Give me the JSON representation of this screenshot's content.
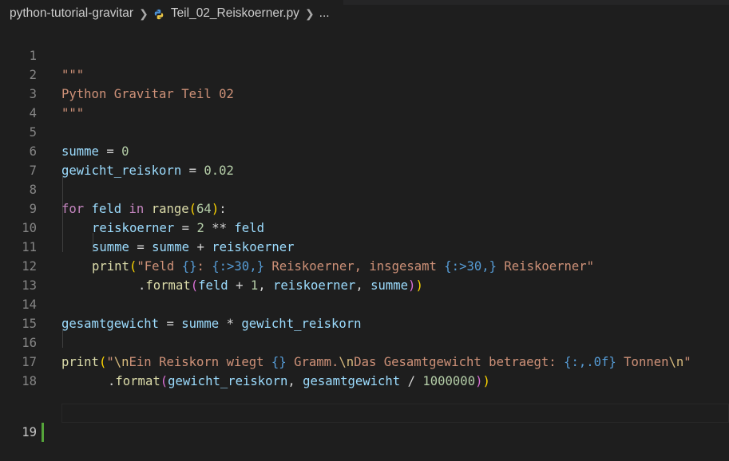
{
  "breadcrumb": {
    "folder": "python-tutorial-gravitar",
    "file": "Teil_02_Reiskoerner.py",
    "tail": "..."
  },
  "editor": {
    "active_line": 19,
    "lines": [
      {
        "num": "1"
      },
      {
        "num": "2"
      },
      {
        "num": "3"
      },
      {
        "num": "4"
      },
      {
        "num": "5"
      },
      {
        "num": "6"
      },
      {
        "num": "7"
      },
      {
        "num": "8"
      },
      {
        "num": "9"
      },
      {
        "num": "10"
      },
      {
        "num": "11"
      },
      {
        "num": "12"
      },
      {
        "num": "13"
      },
      {
        "num": "14"
      },
      {
        "num": "15"
      },
      {
        "num": "16"
      },
      {
        "num": "17"
      },
      {
        "num": "18"
      },
      {
        "num": "19"
      }
    ],
    "tokens": {
      "l1": "\"\"\"",
      "l2": "Python Gravitar Teil 02",
      "l3": "\"\"\"",
      "l5_var": "summe",
      "l5_op": " = ",
      "l5_num": "0",
      "l6_var": "gewicht_reiskorn",
      "l6_op": " = ",
      "l6_num": "0.02",
      "l8_for": "for",
      "l8_var": " feld ",
      "l8_in": "in",
      "l8_sp": " ",
      "l8_fn": "range",
      "l8_open": "(",
      "l8_num": "64",
      "l8_close": ")",
      "l8_colon": ":",
      "l9_var": "reiskoerner",
      "l9_op": " = ",
      "l9_num": "2",
      "l9_op2": " ** ",
      "l9_var2": "feld",
      "l10_var": "summe",
      "l10_op": " = ",
      "l10_var2": "summe",
      "l10_op2": " + ",
      "l10_var3": "reiskoerner",
      "l11_fn": "print",
      "l11_open": "(",
      "l11_s1": "\"Feld ",
      "l11_p1": "{}",
      "l11_s2": ": ",
      "l11_p2": "{:>30,}",
      "l11_s3": " Reiskoerner, insgesamt ",
      "l11_p3": "{:>30,}",
      "l11_s4": " Reiskoerner\"",
      "l12_dot": ".",
      "l12_fn": "format",
      "l12_open": "(",
      "l12_var": "feld",
      "l12_op": " + ",
      "l12_num": "1",
      "l12_comma": ", ",
      "l12_var2": "reiskoerner",
      "l12_comma2": ", ",
      "l12_var3": "summe",
      "l12_close": ")",
      "l12_close2": ")",
      "l14_var": "gesamtgewicht",
      "l14_op": " = ",
      "l14_var2": "summe",
      "l14_op2": " * ",
      "l14_var3": "gewicht_reiskorn",
      "l16_fn": "print",
      "l16_open": "(",
      "l16_s1": "\"",
      "l16_e1": "\\n",
      "l16_s2": "Ein Reiskorn wiegt ",
      "l16_p1": "{}",
      "l16_s3": " Gramm.",
      "l16_e2": "\\n",
      "l16_s4": "Das Gesamtgewicht betraegt: ",
      "l16_p2": "{:,.0f}",
      "l16_s5": " Tonnen",
      "l16_e3": "\\n",
      "l16_s6": "\"",
      "l17_dot": ".",
      "l17_fn": "format",
      "l17_open": "(",
      "l17_var": "gewicht_reiskorn",
      "l17_comma": ", ",
      "l17_var2": "gesamtgewicht",
      "l17_op": " / ",
      "l17_num": "1000000",
      "l17_close": ")",
      "l17_close2": ")"
    }
  },
  "colors": {
    "background": "#1e1e1e",
    "string": "#ce9178",
    "keyword": "#c586c0",
    "function": "#dcdcaa",
    "variable": "#9cdcfe",
    "number": "#b5cea8",
    "bracket_level1": "#ffd700",
    "bracket_level2": "#da70d6",
    "placeholder": "#569cd6",
    "escape": "#d7ba7d",
    "line_number": "#858585",
    "modified_gutter": "#55a43a"
  },
  "icons": {
    "breadcrumb_separator": "chevron-right-icon",
    "file_icon": "python-icon"
  }
}
